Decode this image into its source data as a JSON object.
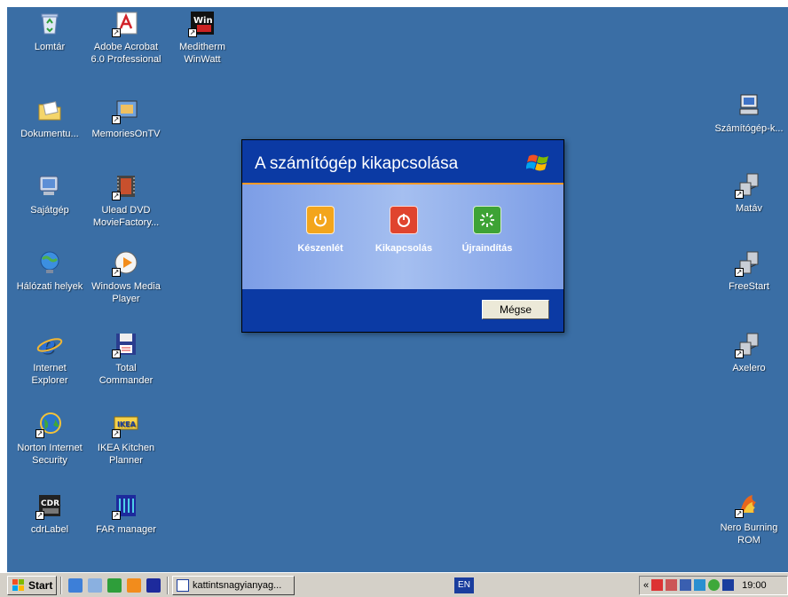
{
  "desktop_icons": [
    {
      "name": "recycle-bin",
      "label": "Lomtár",
      "icon": "recycle-bin-icon"
    },
    {
      "name": "adobe-acrobat",
      "label": "Adobe Acrobat\n6.0 Professional",
      "icon": "acrobat-icon"
    },
    {
      "name": "meditherm",
      "label": "Meditherm\nWinWatt",
      "icon": "winwatt-icon"
    },
    {
      "name": "documents",
      "label": "Dokumentu...",
      "icon": "folder-icon"
    },
    {
      "name": "memoriesontv",
      "label": "MemoriesOnTV",
      "icon": "memoriesontv-icon"
    },
    {
      "name": "my-computer",
      "label": "Sajátgép",
      "icon": "computer-icon"
    },
    {
      "name": "ulead-dvd",
      "label": "Ulead DVD\nMovieFactory...",
      "icon": "film-icon"
    },
    {
      "name": "network-places",
      "label": "Hálózati helyek",
      "icon": "network-icon"
    },
    {
      "name": "windows-media-player",
      "label": "Windows Media\nPlayer",
      "icon": "media-player-icon"
    },
    {
      "name": "internet-explorer",
      "label": "Internet\nExplorer",
      "icon": "ie-icon"
    },
    {
      "name": "total-commander",
      "label": "Total\nCommander",
      "icon": "floppy-icon"
    },
    {
      "name": "norton",
      "label": "Norton Internet\nSecurity",
      "icon": "globe-icon"
    },
    {
      "name": "ikea",
      "label": "IKEA Kitchen\nPlanner",
      "icon": "ikea-icon"
    },
    {
      "name": "cdrlabel",
      "label": "cdrLabel",
      "icon": "cdr-icon"
    },
    {
      "name": "far-manager",
      "label": "FAR manager",
      "icon": "far-icon"
    },
    {
      "name": "szamitogep",
      "label": "Számítógép-k...",
      "icon": "pc-icon"
    },
    {
      "name": "matav",
      "label": "Matáv",
      "icon": "dialup-icon"
    },
    {
      "name": "freestart",
      "label": "FreeStart",
      "icon": "dialup-icon"
    },
    {
      "name": "axelero",
      "label": "Axelero",
      "icon": "dialup-icon"
    },
    {
      "name": "nero",
      "label": "Nero Burning\nROM",
      "icon": "nero-icon"
    }
  ],
  "dialog": {
    "title": "A számítógép kikapcsolása",
    "logo_icon": "windows-flag-icon",
    "options": [
      {
        "label": "Készenlét",
        "icon": "standby-icon",
        "color": "#f3a51c"
      },
      {
        "label": "Kikapcsolás",
        "icon": "power-icon",
        "color": "#e0442e"
      },
      {
        "label": "Újraindítás",
        "icon": "restart-icon",
        "color": "#3ea335"
      }
    ],
    "cancel_label": "Mégse"
  },
  "taskbar": {
    "start_label": "Start",
    "task_label": "kattintsnagyianyag...",
    "lang": "EN",
    "tray_chevron": "«",
    "clock": "19:00"
  },
  "colors": {
    "desktop_bg": "#3a6ea5",
    "dialog_header": "#0b3aa4",
    "dialog_accent": "#ff9a28"
  }
}
